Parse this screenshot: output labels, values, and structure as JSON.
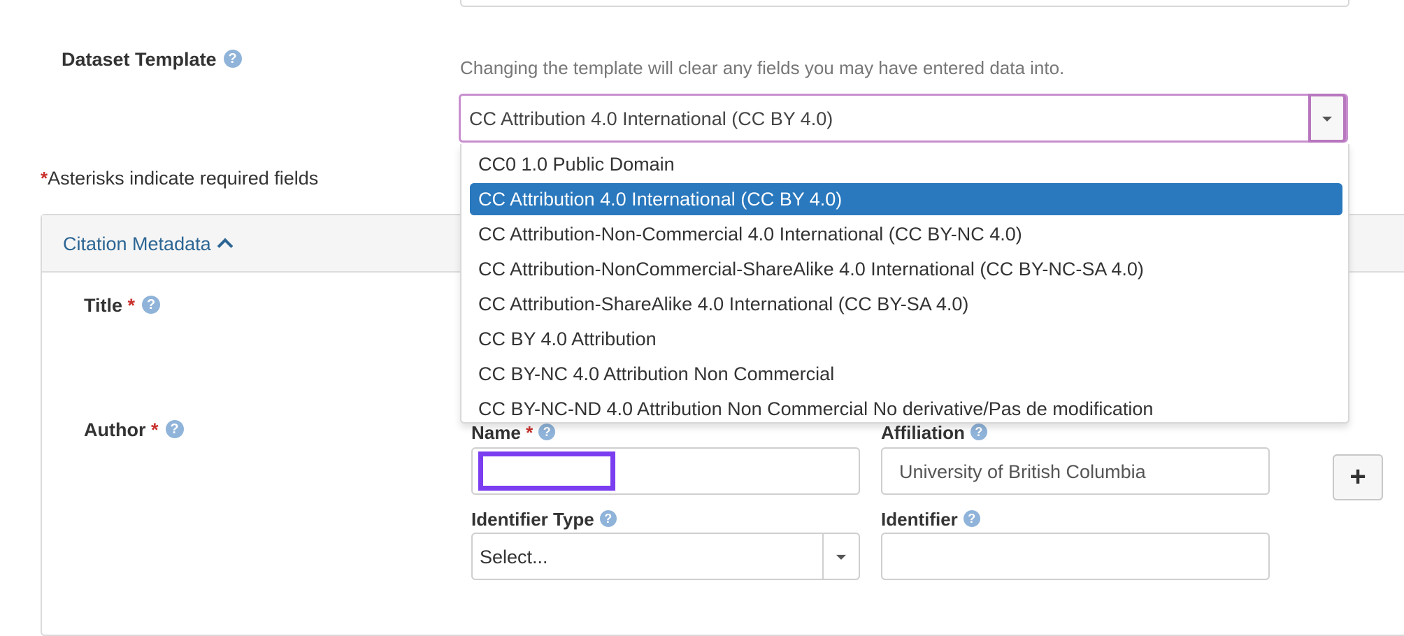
{
  "template": {
    "label": "Dataset Template",
    "help_icon": "question-circle-icon",
    "help_text": "Changing the template will clear any fields you may have entered data into.",
    "selected": "CC Attribution 4.0 International (CC BY 4.0)",
    "options": [
      "CC0 1.0 Public Domain",
      "CC Attribution 4.0 International (CC BY 4.0)",
      "CC Attribution-Non-Commercial 4.0 International (CC BY-NC 4.0)",
      "CC Attribution-NonCommercial-ShareAlike 4.0 International (CC BY-NC-SA 4.0)",
      "CC Attribution-ShareAlike 4.0 International (CC BY-SA 4.0)",
      "CC BY 4.0 Attribution",
      "CC BY-NC 4.0 Attribution Non Commercial",
      "CC BY-NC-ND 4.0 Attribution Non Commercial No derivative/Pas de modification"
    ],
    "highlighted_index": 1
  },
  "required_note": {
    "asterisk": "*",
    "text": "Asterisks indicate required fields"
  },
  "citation": {
    "title": "Citation Metadata",
    "title_label": "Title",
    "author_label": "Author",
    "required_mark": "*",
    "author": {
      "name_label": "Name",
      "affiliation_label": "Affiliation",
      "affiliation_value": "University of British Columbia",
      "identifier_type_label": "Identifier Type",
      "identifier_type_value": "Select...",
      "identifier_label": "Identifier",
      "add_label": "+"
    }
  },
  "colors": {
    "accent_link": "#2c6593",
    "selected_option": "#2a78bd",
    "focus_border": "#b776be",
    "name_highlight": "#7b3df0",
    "required": "#c9302c",
    "help_icon": "#8fb3d9"
  }
}
